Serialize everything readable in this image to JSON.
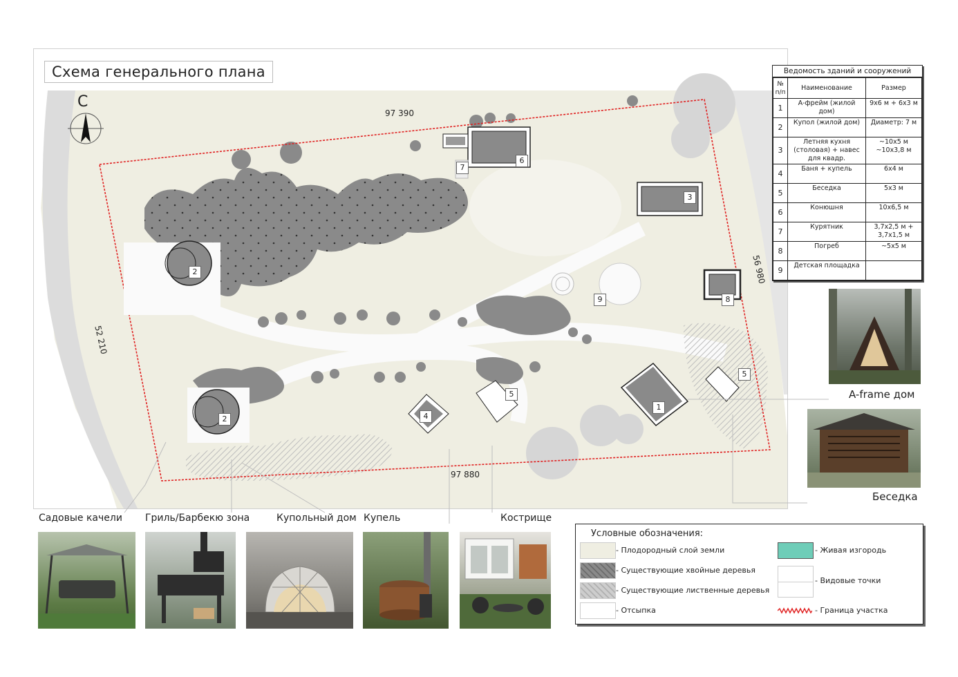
{
  "title": "Схема генерального плана",
  "north_letter": "С",
  "dimensions": {
    "top": "97 390",
    "bottom": "97 880",
    "left": "52 210",
    "right": "56 980"
  },
  "buildings_schedule": {
    "title": "Ведомость зданий и сооружений",
    "headers": {
      "num": "№ п/п",
      "name": "Наименование",
      "size": "Размер"
    },
    "rows": [
      {
        "num": "1",
        "name": "А-фрейм (жилой дом)",
        "size": "9х6 м + 6х3 м"
      },
      {
        "num": "2",
        "name": "Купол (жилой дом)",
        "size": "Диаметр: 7 м"
      },
      {
        "num": "3",
        "name": "Летняя кухня (столовая) + навес для квадр.",
        "size": "~10х5 м ~10х3,8 м"
      },
      {
        "num": "4",
        "name": "Баня + купель",
        "size": "6х4 м"
      },
      {
        "num": "5",
        "name": "Беседка",
        "size": "5х3 м"
      },
      {
        "num": "6",
        "name": "Конюшня",
        "size": "10х6,5 м"
      },
      {
        "num": "7",
        "name": "Курятник",
        "size": "3,7х2,5 м + 3,7х1,5 м"
      },
      {
        "num": "8",
        "name": "Погреб",
        "size": "~5х5 м"
      },
      {
        "num": "9",
        "name": "Детская площадка",
        "size": ""
      }
    ]
  },
  "plan_labels": [
    "1",
    "2",
    "2",
    "3",
    "4",
    "5",
    "5",
    "6",
    "7",
    "8",
    "9"
  ],
  "photos_right": [
    {
      "caption": "A-frame дом",
      "icon": "a-frame-house-photo"
    },
    {
      "caption": "Беседка",
      "icon": "gazebo-photo"
    }
  ],
  "photos_bottom": [
    {
      "caption": "Садовые качели",
      "icon": "garden-swing-photo"
    },
    {
      "caption": "Гриль/Барбекю зона",
      "icon": "grill-photo"
    },
    {
      "caption": "Купольный дом",
      "icon": "dome-house-photo"
    },
    {
      "caption": "Купель",
      "icon": "hot-tub-photo"
    },
    {
      "caption": "Кострище",
      "icon": "fire-pit-photo"
    }
  ],
  "legend": {
    "title": "Условные обозначения:",
    "items": [
      {
        "label": "- Плодородный слой земли",
        "color": "#efeee2"
      },
      {
        "label": "- Существующие хвойные деревья",
        "color": "#8a8a8a"
      },
      {
        "label": "- Существующие лиственные деревья",
        "color": "#c9c9c9"
      },
      {
        "label": "- Отсыпка",
        "color": "#ffffff"
      },
      {
        "label": "- Живая изгородь",
        "color": "#6ecdb8"
      },
      {
        "label": "- Видовые точки",
        "color": "#ffffff"
      },
      {
        "label": "- Граница участка",
        "color": "#e02020"
      }
    ]
  },
  "colors": {
    "soil": "#efeee2",
    "conifer": "#858585",
    "deciduous": "#c8c8c8",
    "boundary": "#e02020",
    "hedge": "#6ecdb8"
  }
}
